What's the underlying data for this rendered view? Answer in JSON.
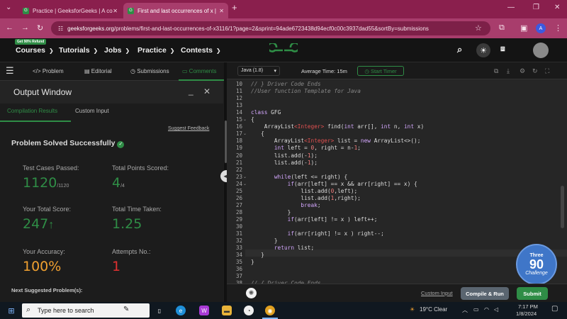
{
  "browser": {
    "tabs": [
      {
        "title": "Practice | GeeksforGeeks | A co",
        "favicon": "gfg-icon"
      },
      {
        "title": "First and last occurrences of x |",
        "favicon": "gfg-icon"
      }
    ],
    "url_host": "geeksforgeeks.org",
    "url_path": "/problems/first-and-last-occurrences-of-x3116/1?page=2&sprint=94ade6723438d94ecf0c00c3937dad55&sortBy=submissions",
    "profile_initial": "A"
  },
  "gfg_nav": {
    "refund_badge": "Get 90% Refund",
    "items": [
      "Courses",
      "Tutorials",
      "Jobs",
      "Practice",
      "Contests"
    ],
    "logo_text": "GG"
  },
  "problem_tabs": [
    {
      "label": "Problem",
      "icon": "code-icon"
    },
    {
      "label": "Editorial",
      "icon": "document-icon"
    },
    {
      "label": "Submissions",
      "icon": "clock-icon"
    },
    {
      "label": "Comments",
      "icon": "chat-icon"
    }
  ],
  "output": {
    "title": "Output Window",
    "tab_results": "Compilation Results",
    "tab_custom": "Custom Input",
    "suggest": "Suggest Feedback",
    "status": "Problem Solved Successfully",
    "test_cases_label": "Test Cases Passed:",
    "test_cases_value": "1120",
    "test_cases_total": "/1120",
    "points_label": "Total Points Scored:",
    "points_value": "4",
    "points_total": "/4",
    "score_label": "Your Total Score:",
    "score_value": "247",
    "time_label": "Total Time Taken:",
    "time_value": "1.25",
    "accuracy_label": "Your Accuracy:",
    "accuracy_value": "100%",
    "attempts_label": "Attempts No.:",
    "attempts_value": "1",
    "next_label": "Next Suggested Problem(s):"
  },
  "editor_header": {
    "language": "Java (1.8)",
    "avg_time": "Average Time: 15m",
    "start_timer": "Start Timer"
  },
  "code_lines": [
    {
      "n": "10",
      "html": "<span class=\"cm\">// } Driver Code Ends</span>"
    },
    {
      "n": "11",
      "html": "<span class=\"cm\">//User function Template for Java</span>"
    },
    {
      "n": "12",
      "html": ""
    },
    {
      "n": "13",
      "html": ""
    },
    {
      "n": "14",
      "html": "<span class=\"kw\">class</span> GFG"
    },
    {
      "n": "15",
      "html": "{"
    },
    {
      "n": "16",
      "html": "    ArrayList<span class=\"ty\">&lt;Integer&gt;</span> find(<span class=\"kw\">int</span> arr[], <span class=\"kw\">int</span> n, <span class=\"kw\">int</span> x)"
    },
    {
      "n": "17",
      "html": "   {"
    },
    {
      "n": "18",
      "html": "       ArrayList<span class=\"ty\">&lt;Integer&gt;</span> list = <span class=\"kw\">new</span> ArrayList&lt;&gt;();"
    },
    {
      "n": "19",
      "html": "       <span class=\"kw\">int</span> left = <span class=\"num\">0</span>, right = n-<span class=\"num\">1</span>;"
    },
    {
      "n": "20",
      "html": "       list.add(-<span class=\"num\">1</span>);"
    },
    {
      "n": "21",
      "html": "       list.add(-<span class=\"num\">1</span>);"
    },
    {
      "n": "22",
      "html": ""
    },
    {
      "n": "23",
      "html": "       <span class=\"kw\">while</span>(left &lt;= right) {"
    },
    {
      "n": "24",
      "html": "           <span class=\"kw\">if</span>(arr[left] == x &amp;&amp; arr[right] == x) {"
    },
    {
      "n": "25",
      "html": "               list.add(<span class=\"num\">0</span>,left);"
    },
    {
      "n": "26",
      "html": "               list.add(<span class=\"num\">1</span>,right);"
    },
    {
      "n": "27",
      "html": "               <span class=\"kw\">break</span>;"
    },
    {
      "n": "28",
      "html": "           }"
    },
    {
      "n": "29",
      "html": "           <span class=\"kw\">if</span>(arr[left] != x ) left++;"
    },
    {
      "n": "30",
      "html": ""
    },
    {
      "n": "31",
      "html": "           <span class=\"kw\">if</span>(arr[right] != x ) right--;"
    },
    {
      "n": "32",
      "html": "       }"
    },
    {
      "n": "33",
      "html": "       <span class=\"kw\">return</span> list;"
    },
    {
      "n": "34",
      "html": "   }"
    },
    {
      "n": "35",
      "html": "}"
    },
    {
      "n": "36",
      "html": ""
    },
    {
      "n": "37",
      "html": ""
    },
    {
      "n": "38",
      "html": "<span class=\"cm\">// { Driver Code Ends</span>"
    }
  ],
  "challenge": {
    "top": "Three",
    "number": "90",
    "bottom": "Challenge"
  },
  "bottom_bar": {
    "custom_input": "Custom Input",
    "compile": "Compile & Run",
    "submit": "Submit"
  },
  "taskbar": {
    "search_placeholder": "Type here to search",
    "weather": "19°C  Clear",
    "time": "7:17 PM",
    "date": "1/8/2024"
  }
}
